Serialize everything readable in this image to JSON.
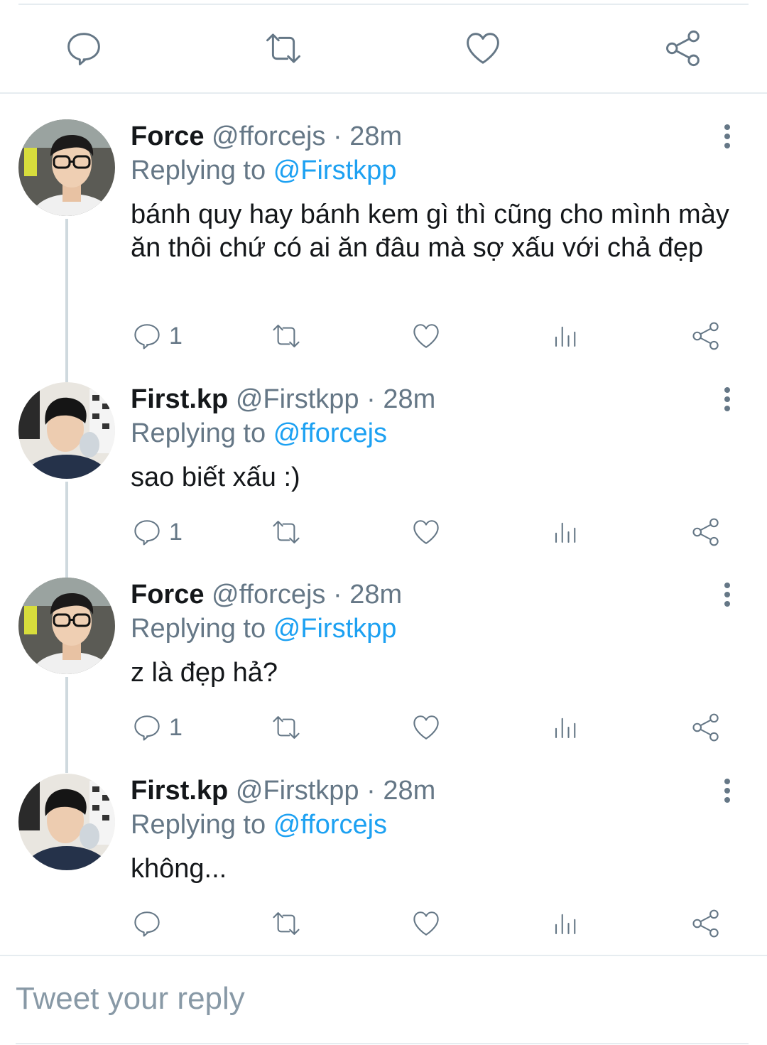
{
  "main_actions": {
    "reply_icon": "speech-bubble-icon",
    "retweet_icon": "retweet-icon",
    "like_icon": "heart-icon",
    "share_icon": "share-icon"
  },
  "tweets": [
    {
      "name": "Force",
      "handle": "@fforcejs",
      "dot": "·",
      "time": "28m",
      "replying_prefix": "Replying to",
      "replying_to": "@Firstkpp",
      "text": "bánh quy hay bánh kem gì thì cũng cho mình mày ăn thôi chứ có ai ăn đâu mà sợ xấu với chả đẹp",
      "reply_count": "1"
    },
    {
      "name": "First.kp",
      "handle": "@Firstkpp",
      "dot": "·",
      "time": "28m",
      "replying_prefix": "Replying to",
      "replying_to": "@fforcejs",
      "text": "sao biết xấu :)",
      "reply_count": "1"
    },
    {
      "name": "Force",
      "handle": "@fforcejs",
      "dot": "·",
      "time": "28m",
      "replying_prefix": "Replying to",
      "replying_to": "@Firstkpp",
      "text": "z là đẹp hả?",
      "reply_count": "1"
    },
    {
      "name": "First.kp",
      "handle": "@Firstkpp",
      "dot": "·",
      "time": "28m",
      "replying_prefix": "Replying to",
      "replying_to": "@fforcejs",
      "text": "không...",
      "reply_count": ""
    }
  ],
  "reply_box": {
    "placeholder": "Tweet your reply"
  },
  "colors": {
    "accent": "#1da1f2",
    "secondary_text": "#657786",
    "divider": "#e6ecf0"
  }
}
